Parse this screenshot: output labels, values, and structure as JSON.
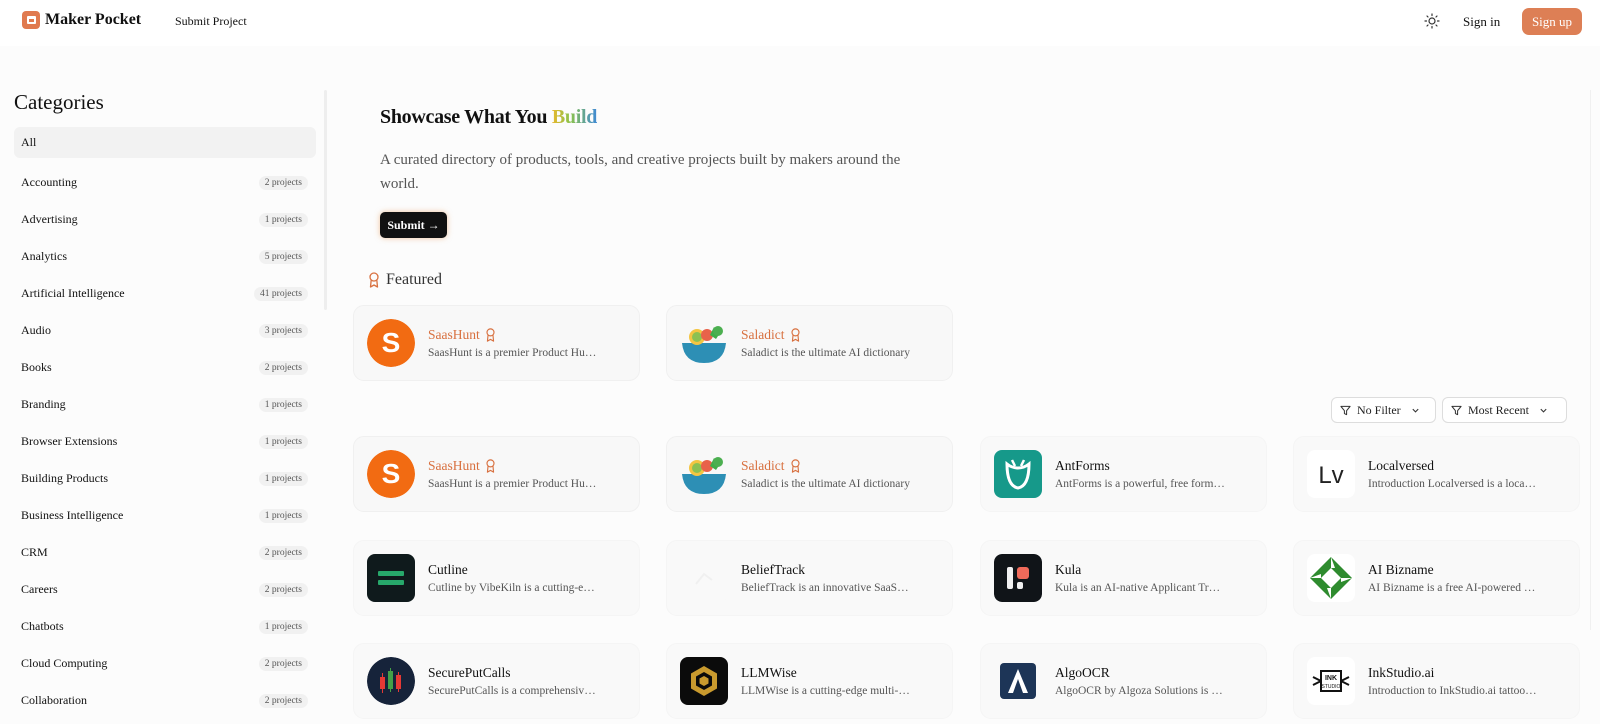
{
  "header": {
    "brand": "Maker Pocket",
    "nav_submit": "Submit Project",
    "signin": "Sign in",
    "signup": "Sign up",
    "accent": "#dd7f55"
  },
  "sidebar": {
    "title": "Categories",
    "items": [
      {
        "label": "All",
        "count": ""
      },
      {
        "label": "Accounting",
        "count": "2 projects"
      },
      {
        "label": "Advertising",
        "count": "1 projects"
      },
      {
        "label": "Analytics",
        "count": "5 projects"
      },
      {
        "label": "Artificial Intelligence",
        "count": "41 projects"
      },
      {
        "label": "Audio",
        "count": "3 projects"
      },
      {
        "label": "Books",
        "count": "2 projects"
      },
      {
        "label": "Branding",
        "count": "1 projects"
      },
      {
        "label": "Browser Extensions",
        "count": "1 projects"
      },
      {
        "label": "Building Products",
        "count": "1 projects"
      },
      {
        "label": "Business Intelligence",
        "count": "1 projects"
      },
      {
        "label": "CRM",
        "count": "2 projects"
      },
      {
        "label": "Careers",
        "count": "2 projects"
      },
      {
        "label": "Chatbots",
        "count": "1 projects"
      },
      {
        "label": "Cloud Computing",
        "count": "2 projects"
      },
      {
        "label": "Collaboration",
        "count": "2 projects"
      }
    ]
  },
  "hero": {
    "title_prefix": "Showcase What You ",
    "title_highlight": "Build",
    "description": "A curated directory of products, tools, and creative projects built by makers around the world.",
    "submit": "Submit"
  },
  "featured": {
    "label": "Featured",
    "items": [
      {
        "name": "SaasHunt",
        "desc": "SaasHunt is a premier Product Hunt alternative",
        "icon": "saashunt-logo",
        "featured": true
      },
      {
        "name": "Saladict",
        "desc": "Saladict is the ultimate AI dictionary",
        "icon": "saladict-logo",
        "featured": true
      }
    ]
  },
  "filters": {
    "filter_label": "No Filter",
    "sort_label": "Most Recent"
  },
  "projects": [
    {
      "name": "SaasHunt",
      "desc": "SaasHunt is a premier Product Hunt alternative",
      "icon": "saashunt-logo",
      "featured": true
    },
    {
      "name": "Saladict",
      "desc": "Saladict is the ultimate AI dictionary",
      "icon": "saladict-logo",
      "featured": true
    },
    {
      "name": "AntForms",
      "desc": "AntForms is a powerful, free form builder",
      "icon": "antforms-logo",
      "featured": false
    },
    {
      "name": "Localversed",
      "desc": "Introduction Localversed is a localization tool",
      "icon": "localversed-logo",
      "featured": false
    },
    {
      "name": "Cutline",
      "desc": "Cutline by VibeKiln is a cutting-edge tool",
      "icon": "cutline-logo",
      "featured": false
    },
    {
      "name": "BeliefTrack",
      "desc": "BeliefTrack is an innovative SaaS platform",
      "icon": "belieftrack-logo",
      "featured": false
    },
    {
      "name": "Kula",
      "desc": "Kula is an AI-native Applicant Tracking System",
      "icon": "kula-logo",
      "featured": false
    },
    {
      "name": "AI Bizname",
      "desc": "AI Bizname is a free AI-powered name generator",
      "icon": "aibizname-logo",
      "featured": false
    },
    {
      "name": "SecurePutCalls",
      "desc": "SecurePutCalls is a comprehensive options tool",
      "icon": "secureputcalls-logo",
      "featured": false
    },
    {
      "name": "LLMWise",
      "desc": "LLMWise is a cutting-edge multi-model platform",
      "icon": "llmwise-logo",
      "featured": false
    },
    {
      "name": "AlgoOCR",
      "desc": "AlgoOCR by Algoza Solutions is an OCR tool",
      "icon": "algoocr-logo",
      "featured": false
    },
    {
      "name": "InkStudio.ai",
      "desc": "Introduction to InkStudio.ai tattoo design",
      "icon": "inkstudio-logo",
      "featured": false
    }
  ]
}
